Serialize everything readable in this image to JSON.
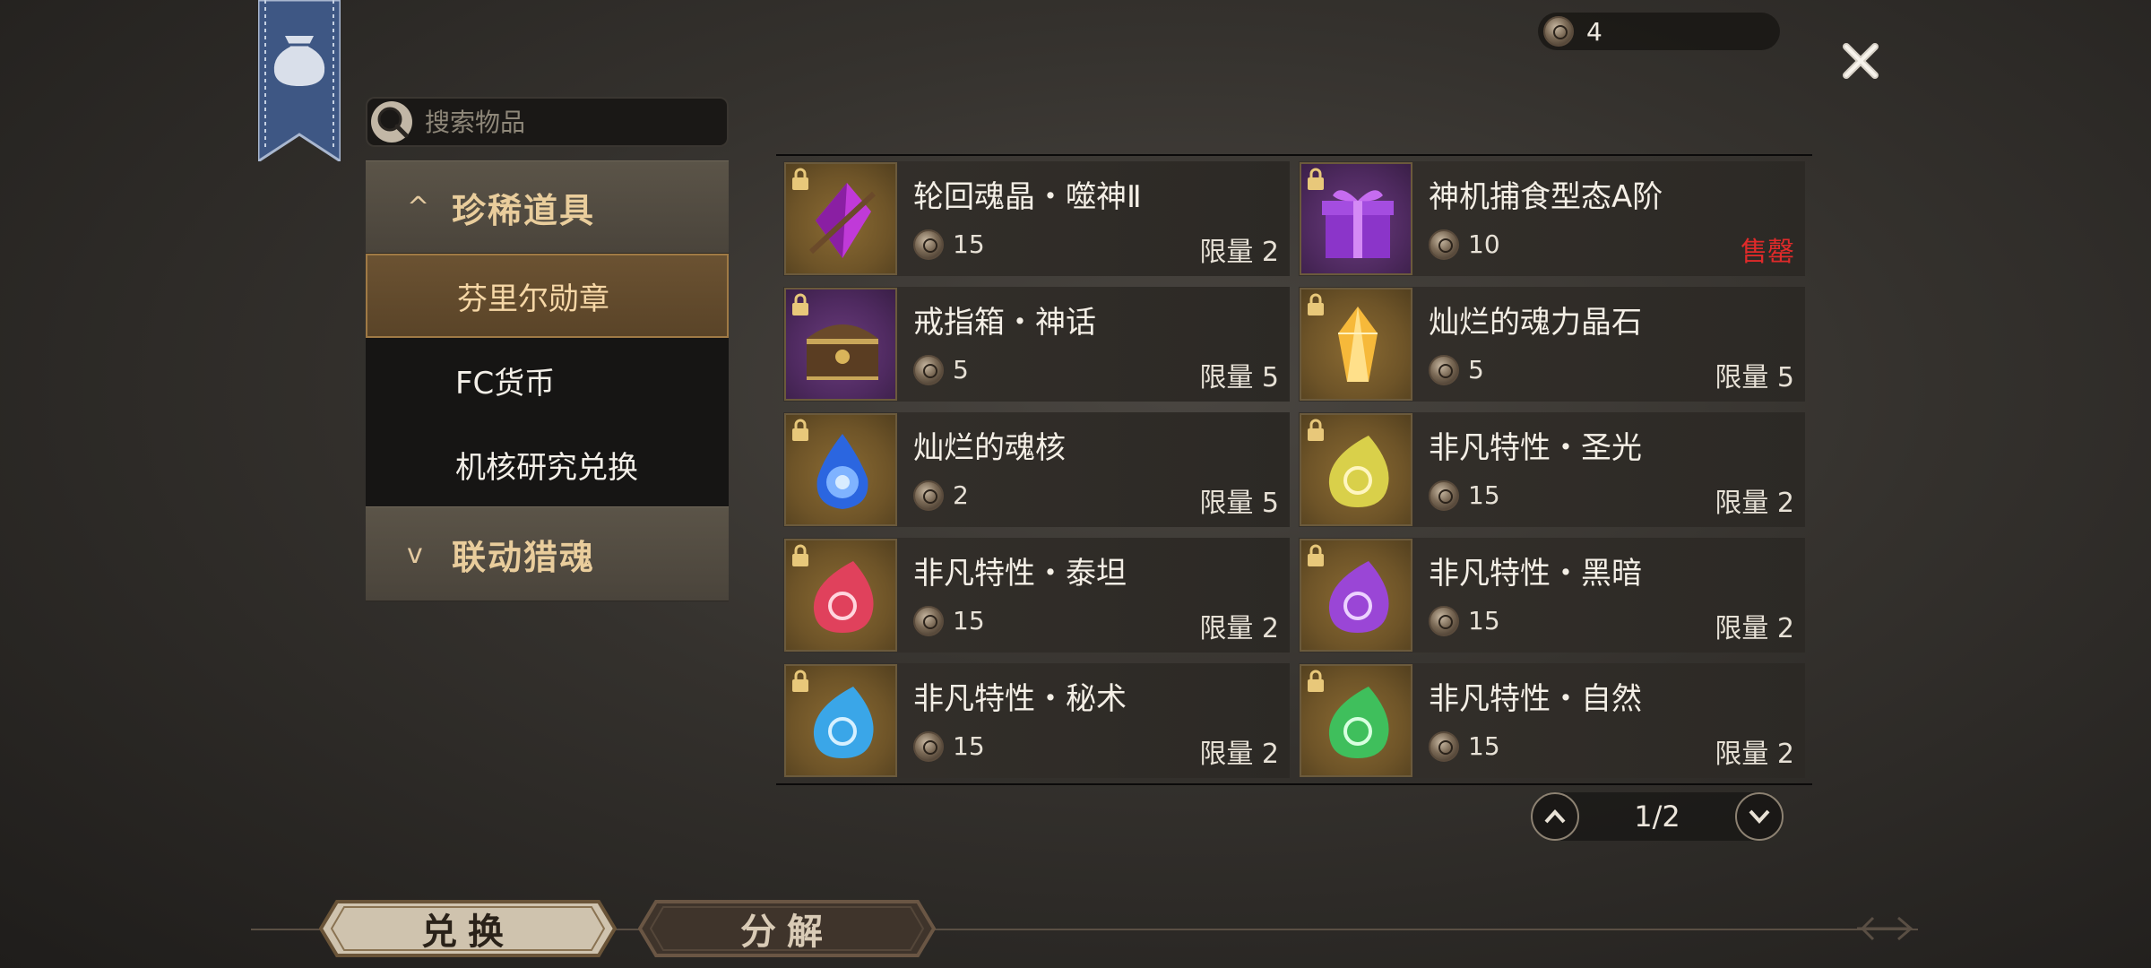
{
  "currency": {
    "amount": "4"
  },
  "search": {
    "placeholder": "搜索物品"
  },
  "sidebar": {
    "categories": [
      {
        "label": "珍稀道具",
        "expanded": true
      },
      {
        "label": "联动猎魂",
        "expanded": false
      }
    ],
    "subitems": [
      "芬里尔勋章",
      "FC货币",
      "机核研究兑换"
    ]
  },
  "items": [
    {
      "name": "轮回魂晶・噬神Ⅱ",
      "price": "15",
      "limit": "限量 2",
      "icon": "purple-crystal-icon"
    },
    {
      "name": "神机捕食型态A阶",
      "price": "10",
      "limit": "售罄",
      "icon": "gift-box-icon"
    },
    {
      "name": "戒指箱・神话",
      "price": "5",
      "limit": "限量 5",
      "icon": "treasure-chest-icon"
    },
    {
      "name": "灿烂的魂力晶石",
      "price": "5",
      "limit": "限量 5",
      "icon": "gold-crystal-icon"
    },
    {
      "name": "灿烂的魂核",
      "price": "2",
      "limit": "限量 5",
      "icon": "blue-flame-icon"
    },
    {
      "name": "非凡特性・圣光",
      "price": "15",
      "limit": "限量 2",
      "icon": "yellow-drop-icon"
    },
    {
      "name": "非凡特性・泰坦",
      "price": "15",
      "limit": "限量 2",
      "icon": "red-drop-icon"
    },
    {
      "name": "非凡特性・黑暗",
      "price": "15",
      "limit": "限量 2",
      "icon": "violet-drop-icon"
    },
    {
      "name": "非凡特性・秘术",
      "price": "15",
      "limit": "限量 2",
      "icon": "blue-drop-icon"
    },
    {
      "name": "非凡特性・自然",
      "price": "15",
      "limit": "限量 2",
      "icon": "green-drop-icon"
    }
  ],
  "pagination": {
    "text": "1/2"
  },
  "bottom_tabs": {
    "exchange": "兑换",
    "decompose": "分解"
  },
  "colors": {
    "sold_out": "#e02a2a",
    "category_text": "#e9cd9c",
    "active_sub_bg": "#6b5232"
  }
}
